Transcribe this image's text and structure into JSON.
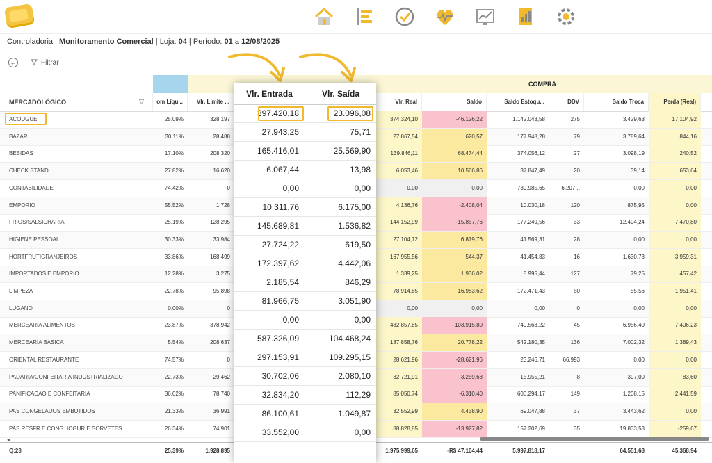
{
  "breadcrumb": {
    "section": "Controladoria",
    "page": "Monitoramento Comercial",
    "loja_label": "Loja:",
    "loja": "04",
    "periodo_label": "Período:",
    "periodo_start": "01",
    "periodo_sep": "a",
    "periodo_end": "12/08/2025"
  },
  "toolbar": {
    "filter_label": "Filtrar"
  },
  "colors": {
    "accent": "#f0b92e",
    "band_blue": "#a8d5ee",
    "band_yellow": "#fbf7d6",
    "negative": "#f9c2cc",
    "positive": "#fbe9a0"
  },
  "grid": {
    "group_compra": "COMPRA",
    "col_headers": [
      "MERCADOLÓGICO",
      "om Líqu...",
      "Vlr. Limite ...",
      "Vlr. Real",
      "Saldo",
      "Saldo Estoqu...",
      "DDV",
      "Saldo Troca",
      "Perda (Real)"
    ],
    "rows": [
      [
        "ACOUGUE",
        "25.09%",
        "328.197",
        "374.324,10",
        "-46.126,22",
        "1.142.043,58",
        "275",
        "3.429,63",
        "17.104,92"
      ],
      [
        "BAZAR",
        "30.11%",
        "28.488",
        "27.867,54",
        "620,57",
        "177.948,28",
        "79",
        "3.789,64",
        "844,16"
      ],
      [
        "BEBIDAS",
        "17.10%",
        "208.320",
        "139.846,11",
        "68.474,44",
        "374.056,12",
        "27",
        "3.098,19",
        "240,52"
      ],
      [
        "CHECK STAND",
        "27.82%",
        "16.620",
        "6.053,46",
        "10.566,86",
        "37.847,49",
        "20",
        "39,14",
        "653,64"
      ],
      [
        "CONTABILIDADE",
        "74.42%",
        "0",
        "0,00",
        "0,00",
        "739.985,65",
        "6.207...",
        "0,00",
        "0,00"
      ],
      [
        "EMPORIO",
        "55.52%",
        "1.728",
        "4.136,76",
        "-2.408,04",
        "10.030,18",
        "120",
        "875,95",
        "0,00"
      ],
      [
        "FRIOS/SALSICHARIA",
        "25.19%",
        "128.295",
        "144.152,99",
        "-15.857,76",
        "177.249,56",
        "33",
        "12.494,24",
        "7.470,80"
      ],
      [
        "HIGIENE PESSOAL",
        "30.33%",
        "33.984",
        "27.104,72",
        "6.879,76",
        "41.569,31",
        "28",
        "0,00",
        "0,00"
      ],
      [
        "HORTFRUTIGRANJEIROS",
        "33.86%",
        "168.499",
        "167.955,56",
        "544,37",
        "41.454,83",
        "16",
        "1.630,73",
        "3.959,31"
      ],
      [
        "IMPORTADOS E EMPORIO",
        "12.28%",
        "3.275",
        "1.339,25",
        "1.936,02",
        "8.995,44",
        "127",
        "79,25",
        "457,42"
      ],
      [
        "LIMPEZA",
        "22.78%",
        "95.898",
        "78.914,85",
        "16.983,62",
        "172.471,43",
        "50",
        "55,56",
        "1.951,41"
      ],
      [
        "LUGANO",
        "0.00%",
        "0",
        "0,00",
        "0,00",
        "0,00",
        "0",
        "0,00",
        "0,00"
      ],
      [
        "MERCEARIA ALIMENTOS",
        "23.87%",
        "378.942",
        "482.857,85",
        "-103.915,80",
        "749.568,22",
        "45",
        "6.956,40",
        "7.406,23"
      ],
      [
        "MERCEARIA BASICA",
        "5.54%",
        "208.637",
        "187.858,76",
        "20.778,22",
        "542.180,35",
        "136",
        "7.002,32",
        "1.389,43"
      ],
      [
        "ORIENTAL RESTAURANTE",
        "74.57%",
        "0",
        "28.621,96",
        "-28.621,96",
        "23.246,71",
        "66.993",
        "0,00",
        "0,00"
      ],
      [
        "PADARIA/CONFEITARIA INDUSTRIALIZADO",
        "22.73%",
        "29.462",
        "32.721,91",
        "-3.259,68",
        "15.955,21",
        "8",
        "397,00",
        "83,60"
      ],
      [
        "PANIFICACAO E CONFEITARIA",
        "36.02%",
        "78.740",
        "85.050,74",
        "-6.310,40",
        "600.294,17",
        "149",
        "1.208,15",
        "2.441,59"
      ],
      [
        "PAS CONGELADOS EMBUTIDOS",
        "21.33%",
        "36.991",
        "32.552,99",
        "4.438,90",
        "69.047,88",
        "37",
        "3.443,62",
        "0,00"
      ],
      [
        "PAS RESFR E CONG. IOGUR E SORVETES",
        "26.34%",
        "74.901",
        "88.828,85",
        "-13.927,82",
        "157.202,69",
        "35",
        "19.833,53",
        "-259,67"
      ]
    ],
    "totals": [
      "Q:23",
      "25,39%",
      "1.928.895",
      "1.975.999,65",
      "-R$ 47.104,44",
      "5.997.818,17",
      "",
      "64.551,68",
      "45.368,94"
    ]
  },
  "overlay": {
    "headers": [
      "Vlr. Entrada",
      "Vlr. Saída"
    ],
    "rows": [
      [
        "397.420,18",
        "23.096,08"
      ],
      [
        "27.943,25",
        "75,71"
      ],
      [
        "165.416,01",
        "25.569,90"
      ],
      [
        "6.067,44",
        "13,98"
      ],
      [
        "0,00",
        "0,00"
      ],
      [
        "10.311,76",
        "6.175,00"
      ],
      [
        "145.689,81",
        "1.536,82"
      ],
      [
        "27.724,22",
        "619,50"
      ],
      [
        "172.397,62",
        "4.442,06"
      ],
      [
        "2.185,54",
        "846,29"
      ],
      [
        "81.966,75",
        "3.051,90"
      ],
      [
        "0,00",
        "0,00"
      ],
      [
        "587.326,09",
        "104.468,24"
      ],
      [
        "297.153,91",
        "109.295,15"
      ],
      [
        "30.702,06",
        "2.080,10"
      ],
      [
        "32.834,20",
        "112,29"
      ],
      [
        "86.100,61",
        "1.049,87"
      ],
      [
        "33.552,00",
        "0,00"
      ]
    ]
  }
}
